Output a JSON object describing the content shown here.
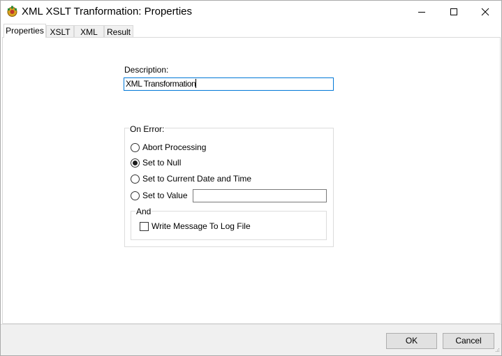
{
  "window": {
    "title": "XML XSLT Tranformation:  Properties",
    "icon": "app-gear-icon"
  },
  "tabs": [
    {
      "label": "Properties",
      "active": true
    },
    {
      "label": "XSLT",
      "active": false
    },
    {
      "label": "XML",
      "active": false
    },
    {
      "label": "Result",
      "active": false
    }
  ],
  "description": {
    "label": "Description:",
    "value": "XML Transformation"
  },
  "on_error": {
    "legend": "On Error:",
    "options": [
      {
        "label": "Abort Processing",
        "checked": false
      },
      {
        "label": "Set to Null",
        "checked": true
      },
      {
        "label": "Set to Current Date and Time",
        "checked": false
      },
      {
        "label": "Set to Value",
        "checked": false
      }
    ],
    "value_field": ""
  },
  "and_group": {
    "legend": "And",
    "checkbox_label": "Write Message To Log File",
    "checked": false
  },
  "buttons": {
    "ok": "OK",
    "cancel": "Cancel"
  }
}
